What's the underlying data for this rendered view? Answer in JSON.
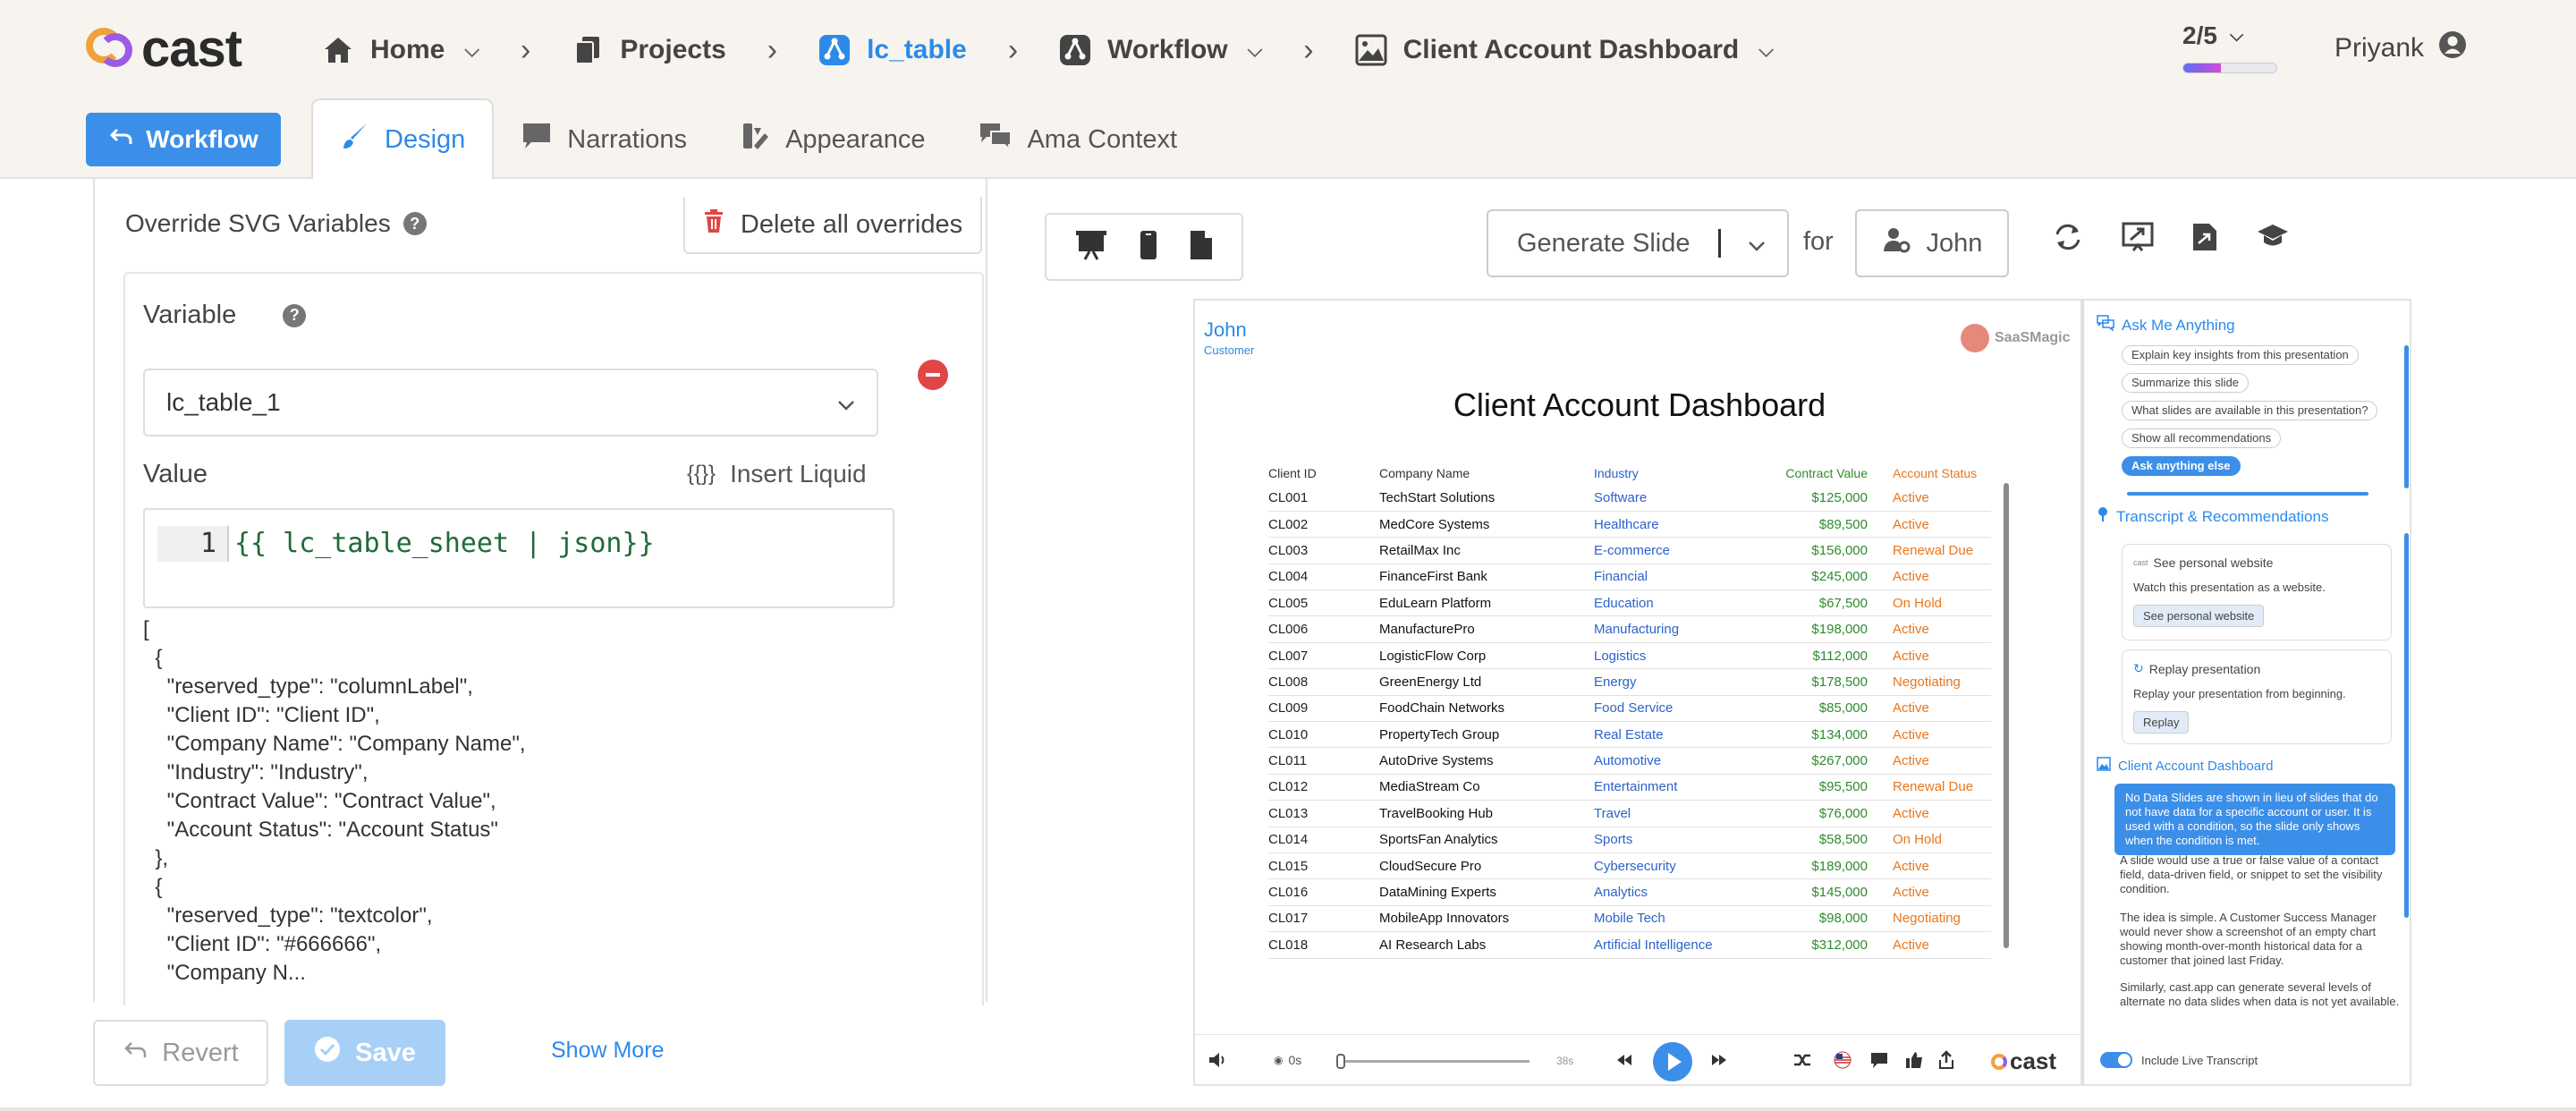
{
  "app": {
    "logo_text": "cast",
    "colors": {
      "accent": "#2d8ae8",
      "primary_button": "#3c8fe8",
      "remove": "#e04646",
      "active_status": "#e8761f",
      "industry": "#2c63c9",
      "contract": "#2e8b2e"
    }
  },
  "breadcrumb": [
    {
      "label": "Home",
      "icon": "home-icon"
    },
    {
      "label": "Projects",
      "icon": "documents-icon"
    },
    {
      "label": "lc_table",
      "icon": "flow-icon"
    },
    {
      "label": "Workflow",
      "icon": "workflow-icon"
    },
    {
      "label": "Client Account Dashboard",
      "icon": "slide-image-icon"
    }
  ],
  "progress": {
    "label": "2/5",
    "fraction": 0.4
  },
  "user": {
    "name": "Priyank"
  },
  "tabs": {
    "workflow_button": "Workflow",
    "items": [
      "Design",
      "Narrations",
      "Appearance",
      "Ama Context"
    ],
    "active": "Design"
  },
  "panel": {
    "override_title": "Override SVG Variables",
    "delete_all": "Delete all overrides",
    "variable_label": "Variable",
    "variable_value": "lc_table_1",
    "value_label": "Value",
    "insert_liquid": "Insert Liquid",
    "insert_liquid_icon": "{{}}",
    "line_number": "1",
    "code": "{{ lc_table_sheet | json}}",
    "json_preview": "[\n  {\n    \"reserved_type\": \"columnLabel\",\n    \"Client ID\": \"Client ID\",\n    \"Company Name\": \"Company Name\",\n    \"Industry\": \"Industry\",\n    \"Contract Value\": \"Contract Value\",\n    \"Account Status\": \"Account Status\"\n  },\n  {\n    \"reserved_type\": \"textcolor\",\n    \"Client ID\": \"#666666\",\n    \"Company N...",
    "show_more": "Show More",
    "revert": "Revert",
    "save": "Save"
  },
  "toolbar": {
    "generate": "Generate Slide",
    "for": "for",
    "recipient": "John"
  },
  "slide": {
    "name": "John",
    "role": "Customer",
    "brand": "SaaSMagic",
    "title": "Client Account Dashboard",
    "columns": [
      "Client ID",
      "Company Name",
      "Industry",
      "Contract Value",
      "Account Status"
    ],
    "rows": [
      [
        "CL001",
        "TechStart Solutions",
        "Software",
        "$125,000",
        "Active"
      ],
      [
        "CL002",
        "MedCore Systems",
        "Healthcare",
        "$89,500",
        "Active"
      ],
      [
        "CL003",
        "RetailMax Inc",
        "E-commerce",
        "$156,000",
        "Renewal Due"
      ],
      [
        "CL004",
        "FinanceFirst Bank",
        "Financial",
        "$245,000",
        "Active"
      ],
      [
        "CL005",
        "EduLearn Platform",
        "Education",
        "$67,500",
        "On Hold"
      ],
      [
        "CL006",
        "ManufacturePro",
        "Manufacturing",
        "$198,000",
        "Active"
      ],
      [
        "CL007",
        "LogisticFlow Corp",
        "Logistics",
        "$112,000",
        "Active"
      ],
      [
        "CL008",
        "GreenEnergy Ltd",
        "Energy",
        "$178,500",
        "Negotiating"
      ],
      [
        "CL009",
        "FoodChain Networks",
        "Food Service",
        "$85,000",
        "Active"
      ],
      [
        "CL010",
        "PropertyTech Group",
        "Real Estate",
        "$134,000",
        "Active"
      ],
      [
        "CL011",
        "AutoDrive Systems",
        "Automotive",
        "$267,000",
        "Active"
      ],
      [
        "CL012",
        "MediaStream Co",
        "Entertainment",
        "$95,500",
        "Renewal Due"
      ],
      [
        "CL013",
        "TravelBooking Hub",
        "Travel",
        "$76,000",
        "Active"
      ],
      [
        "CL014",
        "SportsFan Analytics",
        "Sports",
        "$58,500",
        "On Hold"
      ],
      [
        "CL015",
        "CloudSecure Pro",
        "Cybersecurity",
        "$189,000",
        "Active"
      ],
      [
        "CL016",
        "DataMining Experts",
        "Analytics",
        "$145,000",
        "Active"
      ],
      [
        "CL017",
        "MobileApp Innovators",
        "Mobile Tech",
        "$98,000",
        "Negotiating"
      ],
      [
        "CL018",
        "AI Research Labs",
        "Artificial Intelligence",
        "$312,000",
        "Active"
      ]
    ],
    "player": {
      "start": "0s",
      "end": "38s",
      "logo": "cast"
    }
  },
  "sidebar": {
    "ama_title": "Ask Me Anything",
    "chips": [
      "Explain key insights from this presentation",
      "Summarize this slide",
      "What slides are available in this presentation?",
      "Show all recommendations",
      "Ask anything else"
    ],
    "transcript_title": "Transcript & Recommendations",
    "rec1": {
      "title": "See personal website",
      "desc": "Watch this presentation as a website.",
      "button": "See personal website"
    },
    "rec2": {
      "title": "Replay presentation",
      "desc": "Replay your presentation from beginning.",
      "button": "Replay"
    },
    "section_title": "Client Account Dashboard",
    "highlight": "No Data Slides are shown in lieu of slides that do not have data for a specific account or user. It is used with a condition, so the slide only shows when the condition is met.",
    "para1": "A slide would use a true or false value of a contact field, data-driven field, or snippet to set the visibility condition.",
    "para2": "The idea is simple. A Customer Success Manager would never show a screenshot of an empty chart showing month-over-month historical data for a customer that joined last Friday.",
    "para3": "Similarly, cast.app can generate several levels of alternate no data slides when data is not yet available.",
    "toggle": "Include Live Transcript"
  }
}
